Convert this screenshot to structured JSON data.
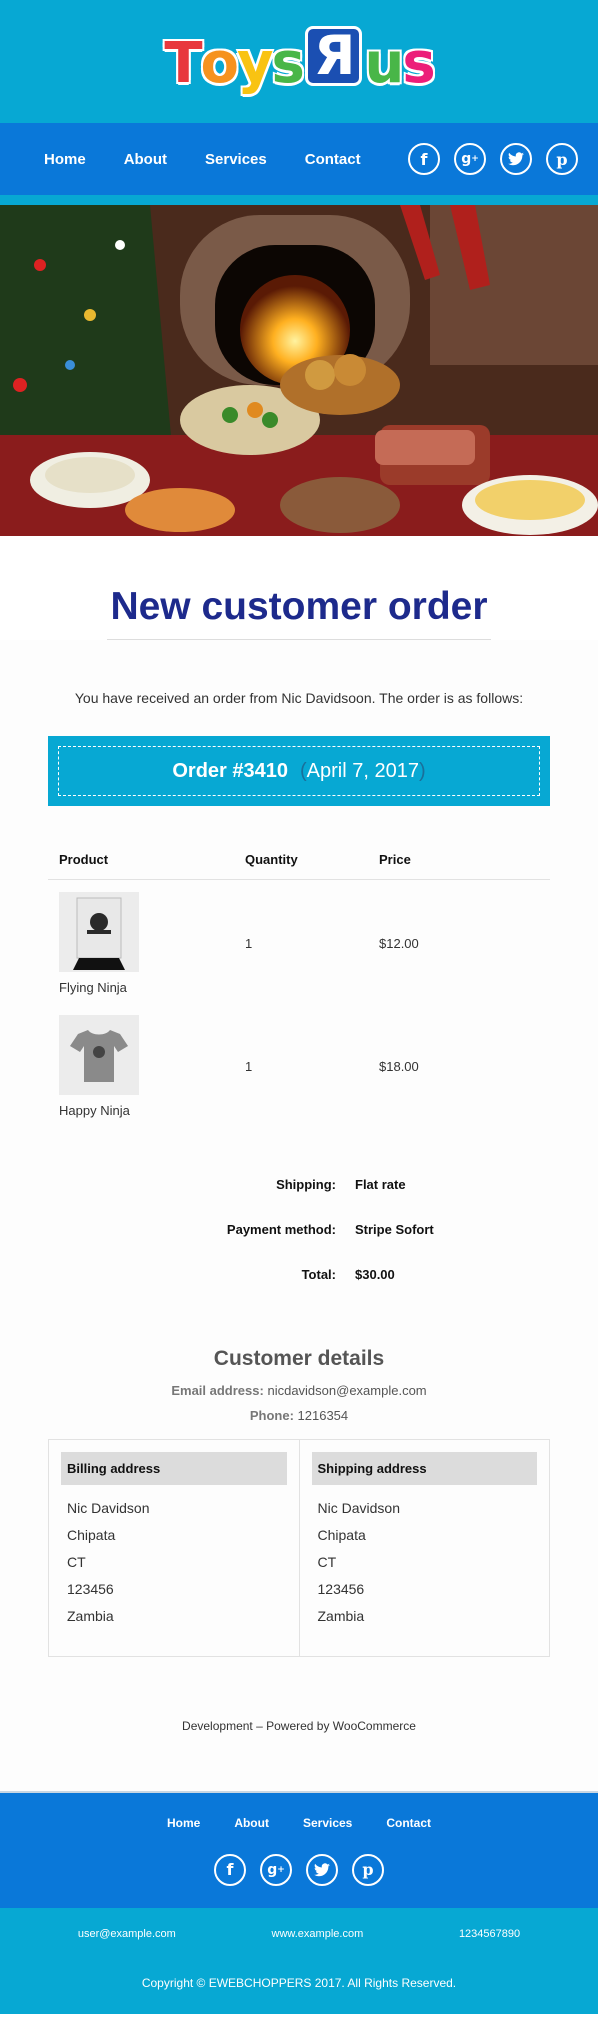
{
  "brand": {
    "logo_text": "Toys R Us"
  },
  "nav": {
    "items": [
      "Home",
      "About",
      "Services",
      "Contact"
    ]
  },
  "social": {
    "icons": [
      "f",
      "g+",
      "t",
      "p"
    ]
  },
  "hero": {
    "image_alt": ""
  },
  "email": {
    "title": "New customer order",
    "intro": "You have received an order from Nic Davidsoon. The order is as follows:",
    "order_number": "Order #3410",
    "order_date": "April 7, 2017",
    "table": {
      "headers": {
        "product": "Product",
        "quantity": "Quantity",
        "price": "Price"
      },
      "rows": [
        {
          "name": "Flying Ninja",
          "qty": "1",
          "price": "$12.00"
        },
        {
          "name": "Happy Ninja",
          "qty": "1",
          "price": "$18.00"
        }
      ]
    },
    "totals": [
      {
        "label": "Shipping:",
        "value": "Flat rate"
      },
      {
        "label": "Payment method:",
        "value": "Stripe Sofort"
      },
      {
        "label": "Total:",
        "value": "$30.00"
      }
    ],
    "customer": {
      "heading": "Customer details",
      "email_label": "Email address:",
      "email": "nicdavidson@example.com",
      "phone_label": "Phone:",
      "phone": "1216354"
    },
    "billing": {
      "heading": "Billing address",
      "lines": [
        "Nic Davidson",
        "Chipata",
        "CT",
        "123456",
        "Zambia"
      ]
    },
    "shipping": {
      "heading": "Shipping address",
      "lines": [
        "Nic Davidson",
        "Chipata",
        "CT",
        "123456",
        "Zambia"
      ]
    },
    "powered": "Development – Powered by WooCommerce"
  },
  "footer": {
    "links": [
      "Home",
      "About",
      "Services",
      "Contact"
    ],
    "email": "user@example.com",
    "website": "www.example.com",
    "phone": "1234567890",
    "copyright": "Copyright © EWEBCHOPPERS 2017. All Rights Reserved."
  },
  "colors": {
    "header_bg": "#07a8d3",
    "nav_bg": "#0a78d9",
    "title": "#1d2a8c"
  }
}
